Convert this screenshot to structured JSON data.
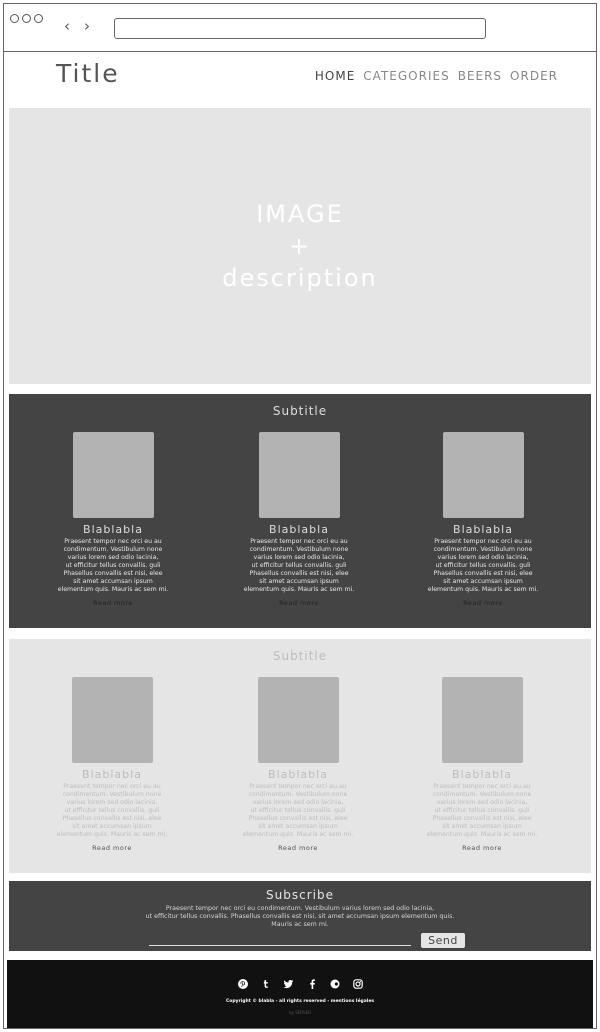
{
  "browser": {
    "back_arrow": "‹",
    "forward_arrow": "›",
    "url": ""
  },
  "header": {
    "title": "Title",
    "nav": [
      "HOME",
      "CATEGORIES",
      "BEERS",
      "ORDER"
    ],
    "active_nav": "HOME"
  },
  "hero": {
    "line1": "IMAGE",
    "line2": "+",
    "line3": "description"
  },
  "section_dark": {
    "title": "Subtitle",
    "cards": [
      {
        "title": "Blablabla",
        "text": "Praesent tempor nec orci eu au\ncondimentum. Vestibulum none\nvarius lorem sed odio lacinia,\nut efficitur tellus convallis. guli\nPhasellus convallis est nisi, elee\nsit amet accumsan ipsum\nelementum quis. Mauris ac sem mi.",
        "link": "Read more"
      },
      {
        "title": "Blablabla",
        "text": "Praesent tempor nec orci eu au\ncondimentum. Vestibulum none\nvarius lorem sed odio lacinia,\nut efficitur tellus convallis. guli\nPhasellus convallis est nisi, elee\nsit amet accumsan ipsum\nelementum quis. Mauris ac sem mi.",
        "link": "Read more"
      },
      {
        "title": "Blablabla",
        "text": "Praesent tempor nec orci eu au\ncondimentum. Vestibulum none\nvarius lorem sed odio lacinia,\nut efficitur tellus convallis. guli\nPhasellus convallis est nisi, elee\nsit amet accumsan ipsum\nelementum quis. Mauris ac sem mi.",
        "link": "Read more"
      }
    ]
  },
  "section_light": {
    "title": "Subtitle",
    "cards": [
      {
        "title": "Blablabla",
        "text": "Praesent tempor nec orci eu au\ncondimentum. Vestibulum none\nvarius lorem sed odio lacinia,\nut efficitur tellus convallis. guli\nPhasellus convallis est nisi, elee\nsit amet accumsan ipsum\nelementum quis. Mauris ac sem mi.",
        "link": "Read more"
      },
      {
        "title": "Blablabla",
        "text": "Praesent tempor nec orci eu au\ncondimentum. Vestibulum none\nvarius lorem sed odio lacinia,\nut efficitur tellus convallis. guli\nPhasellus convallis est nisi, elee\nsit amet accumsan ipsum\nelementum quis. Mauris ac sem mi.",
        "link": "Read more"
      },
      {
        "title": "Blablabla",
        "text": "Praesent tempor nec orci eu au\ncondimentum. Vestibulum none\nvarius lorem sed odio lacinia,\nut efficitur tellus convallis. guli\nPhasellus convallis est nisi, elee\nsit amet accumsan ipsum\nelementum quis. Mauris ac sem mi.",
        "link": "Read more"
      }
    ]
  },
  "subscribe": {
    "title": "Subscribe",
    "text": "Praesent tempor nec orci eu condimentum. Vestibulum varius lorem sed odio lacinia,\nut efficitur tellus convallis. Phasellus convallis est nisi, sit amet accumsan ipsum elementum quis.\nMauris ac sem mi.",
    "input_value": "",
    "send_label": "Send"
  },
  "footer": {
    "socials": [
      "pinterest-icon",
      "tumblr-icon",
      "twitter-icon",
      "facebook-icon",
      "flickr-icon",
      "instagram-icon"
    ],
    "copyright": "Copyright © blabla - all rights reserved - mentions légales",
    "credit": "by SERVER"
  },
  "colors": {
    "dark_section": "#444444",
    "light_section": "#e5e5e5",
    "placeholder_block": "#b3b3b3",
    "footer": "#111111"
  }
}
